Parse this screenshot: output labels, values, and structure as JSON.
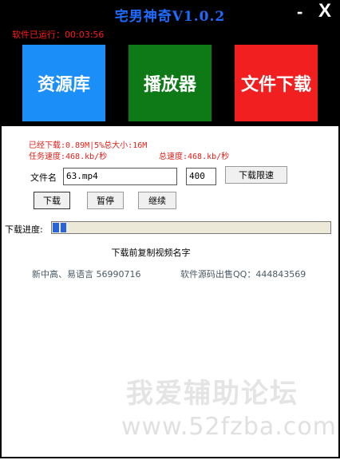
{
  "window": {
    "title": "宅男神奇V1.0.2",
    "minimize_label": "-",
    "close_label": "X",
    "runtime": "软件已运行：00:03:56"
  },
  "nav": {
    "library_label": "资源库",
    "player_label": "播放器",
    "download_label": "文件下载",
    "colors": {
      "library": "#1b8ff7",
      "player": "#0e7a17",
      "download": "#f11f1f"
    }
  },
  "stats": {
    "downloaded": "已经下载:0.89M",
    "percent_total": "|5%总大小:16M",
    "task_speed": "任务速度:468.kb/秒",
    "total_speed": "总速度:468.kb/秒"
  },
  "form": {
    "filename_label": "文件名",
    "filename_value": "63.mp4",
    "limit_value": "400",
    "limit_button": "下载限速",
    "download_button": "下载",
    "pause_button": "暂停",
    "resume_button": "继续"
  },
  "progress": {
    "label": "下载进度:",
    "percent": 5
  },
  "footer": {
    "copy_hint": "下载前复制视频名字",
    "left_text": "新中高、易语言 56990716",
    "right_text": "软件源码出售QQ：444843569"
  },
  "watermark": {
    "line1": "我爱辅助论坛",
    "line2": "www.52fzba.com"
  }
}
